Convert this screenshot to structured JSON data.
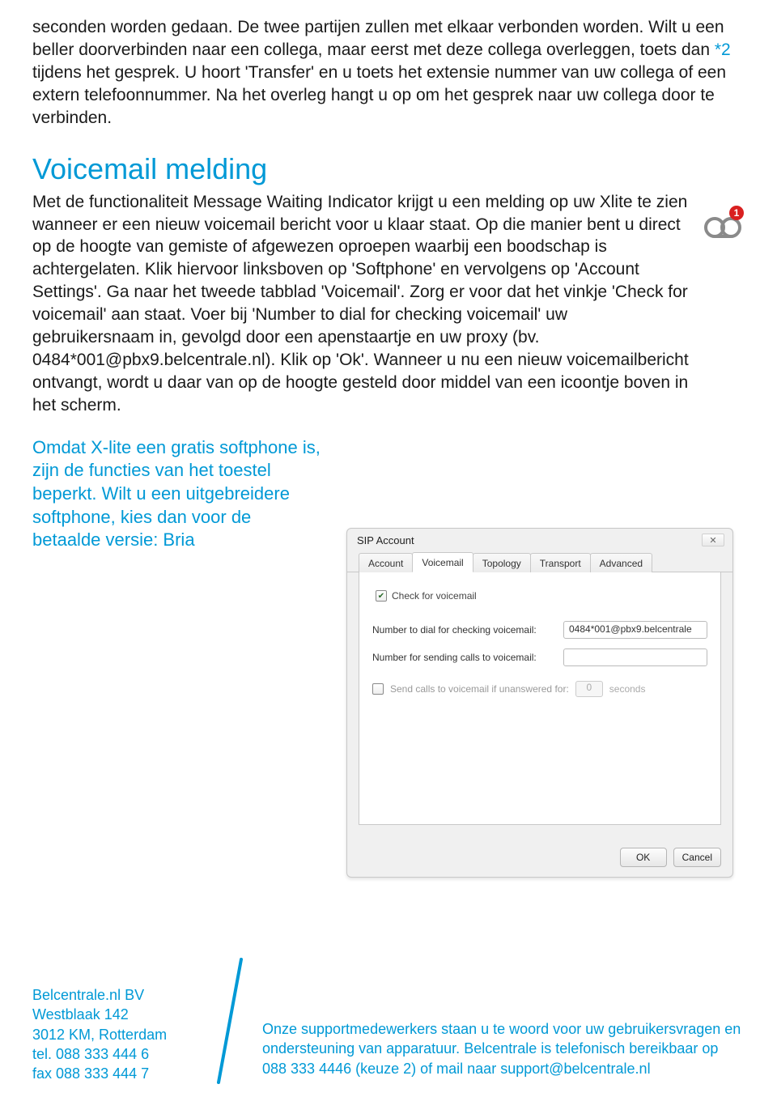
{
  "intro": {
    "text_before": "seconden worden gedaan. De twee partijen zullen met elkaar verbonden worden. Wilt u een beller doorverbinden naar een collega, maar eerst met deze collega overleggen, toets dan ",
    "key": "*2",
    "text_after": " tijdens het gesprek. U hoort 'Transfer' en u toets het extensie nummer van uw collega of een extern telefoonnummer. Na het overleg hangt u op om het gesprek naar uw collega door te verbinden."
  },
  "section": {
    "title": "Voicemail melding",
    "text": "Met de functionaliteit Message Waiting Indicator krijgt u een melding op uw Xlite te zien wanneer er een nieuw voicemail bericht voor u klaar staat. Op die manier bent u direct op de hoogte van gemiste of afgewezen oproepen waarbij een boodschap is achtergelaten. Klik hiervoor linksboven op 'Softphone' en vervolgens op 'Account Settings'. Ga naar het tweede tabblad 'Voicemail'. Zorg er voor dat het vinkje 'Check for voicemail' aan staat. Voer bij 'Number to dial for checking voicemail' uw gebruikersnaam in, gevolgd door een apenstaartje en uw proxy (bv. 0484*001@pbx9.belcentrale.nl). Klik op 'Ok'. Wanneer u nu een nieuw voicemailbericht ontvangt, wordt u daar van op de hoogte gesteld door middel van een icoontje boven in het scherm.",
    "icon_badge": "1"
  },
  "note": "Omdat X-lite een gratis softphone is, zijn de functies van het toestel beperkt. Wilt u een uitgebreidere softphone, kies dan voor de betaalde versie: Bria",
  "dialog": {
    "title": "SIP Account",
    "tabs": [
      "Account",
      "Voicemail",
      "Topology",
      "Transport",
      "Advanced"
    ],
    "active_tab_index": 1,
    "check_label": "Check for voicemail",
    "row1_label": "Number to dial for checking voicemail:",
    "row1_value": "0484*001@pbx9.belcentrale",
    "row2_label": "Number for sending calls to voicemail:",
    "row2_value": "",
    "unanswered_label": "Send calls to voicemail if unanswered for:",
    "unanswered_value": "0",
    "seconds": "seconds",
    "ok": "OK",
    "cancel": "Cancel"
  },
  "footer": {
    "company": {
      "name": "Belcentrale.nl BV",
      "street": "Westblaak 142",
      "city": "3012 KM, Rotterdam",
      "tel": "tel. 088 333 444 6",
      "fax": "fax 088 333 444 7"
    },
    "support": "Onze supportmedewerkers staan u te woord voor uw gebruikersvragen en ondersteuning van apparatuur. Belcentrale is telefonisch bereikbaar op 088 333 4446 (keuze 2) of mail naar support@belcentrale.nl"
  }
}
